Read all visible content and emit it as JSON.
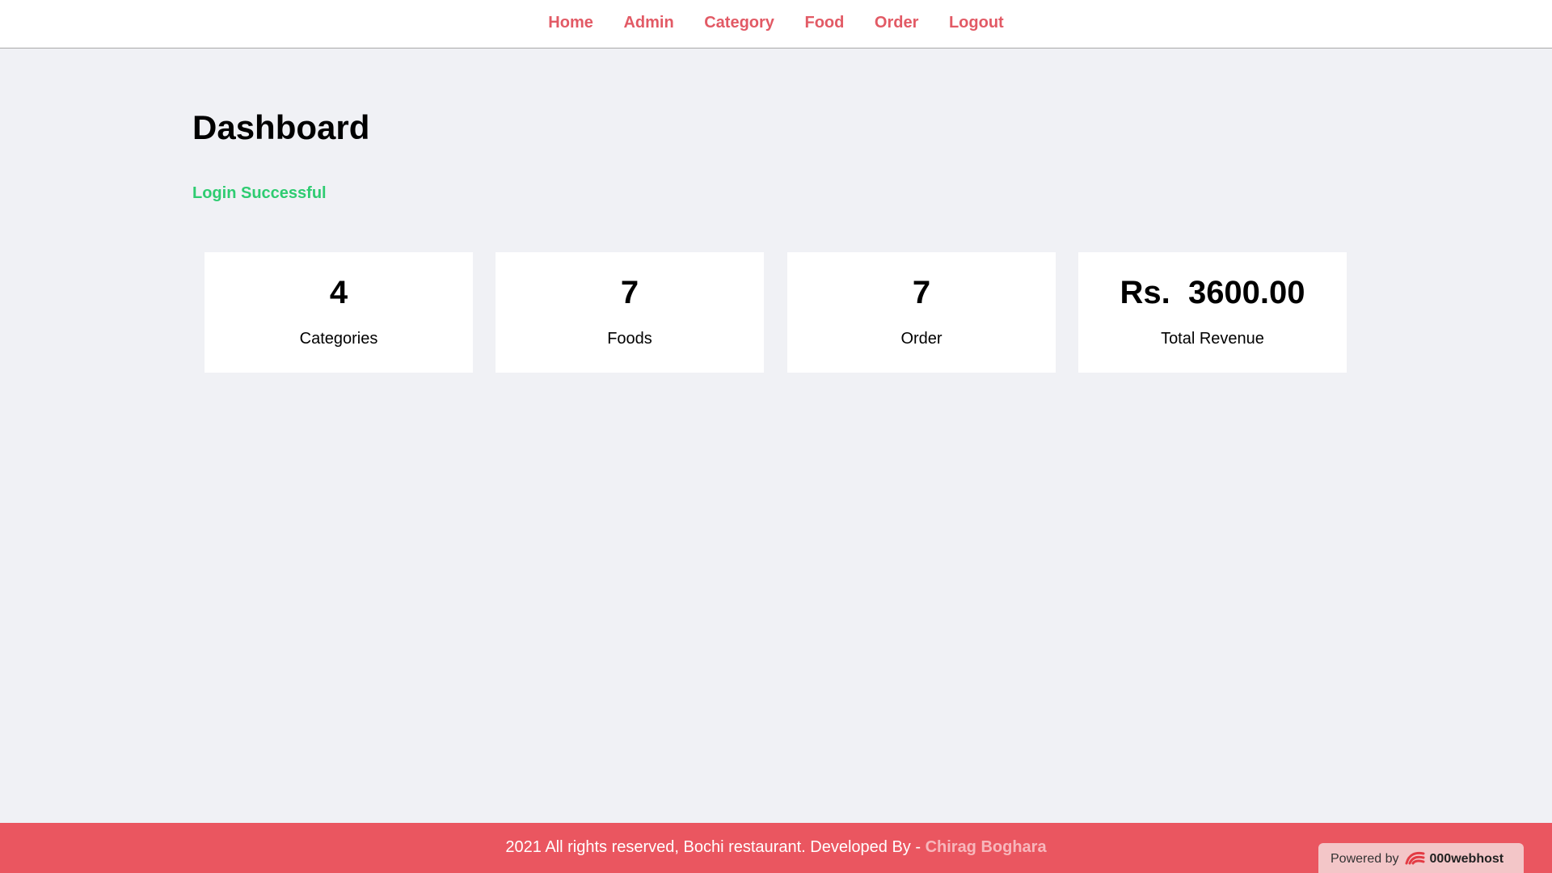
{
  "nav": {
    "items": [
      {
        "label": "Home"
      },
      {
        "label": "Admin"
      },
      {
        "label": "Category"
      },
      {
        "label": "Food"
      },
      {
        "label": "Order"
      },
      {
        "label": "Logout"
      }
    ]
  },
  "page": {
    "title": "Dashboard",
    "status_message": "Login Successful"
  },
  "cards": [
    {
      "value": "4",
      "label": "Categories"
    },
    {
      "value": "7",
      "label": "Foods"
    },
    {
      "value": "7",
      "label": "Order"
    },
    {
      "value": "Rs.  3600.00",
      "label": "Total Revenue"
    }
  ],
  "footer": {
    "text": "2021 All rights reserved, Bochi restaurant. Developed By - ",
    "developer": "Chirag Boghara"
  },
  "badge": {
    "prefix": "Powered by",
    "brand": "000webhost",
    "icon": "000webhost-logo-icon"
  },
  "colors": {
    "accent": "#e25a65",
    "footer_bg": "#ea5660",
    "success": "#2ecc71",
    "page_bg": "#f0f1f5"
  }
}
